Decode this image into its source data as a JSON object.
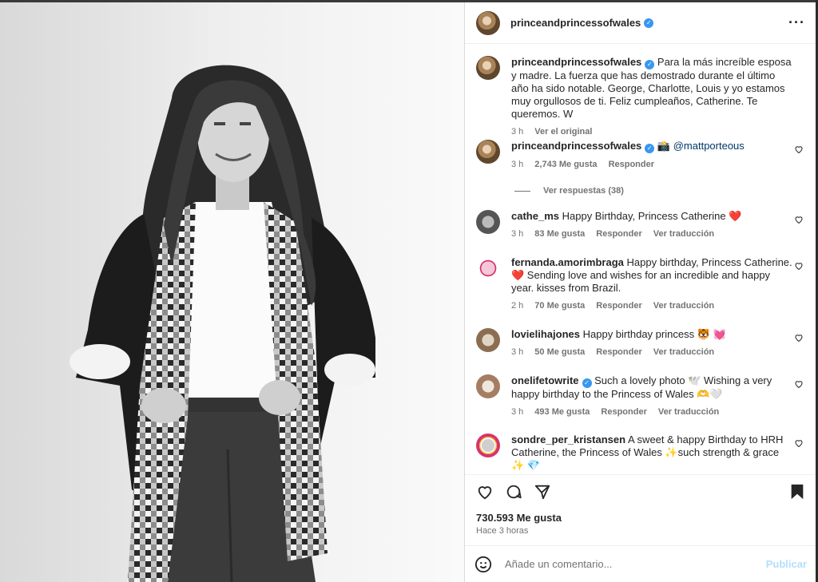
{
  "post": {
    "author": "princeandprincessofwales",
    "caption": "Para la más increíble esposa y madre. La fuerza que has demostrado durante el último año ha sido notable. George, Charlotte, Louis y yo estamos muy orgullosos de ti. Feliz cumpleaños, Catherine. Te queremos. W",
    "caption_time": "3 h",
    "see_original": "Ver el original",
    "likes": "730.593 Me gusta",
    "time_ago": "Hace 3 horas"
  },
  "comments": [
    {
      "user": "princeandprincessofwales",
      "verified": true,
      "text": "📸",
      "mention": "@mattporteous",
      "time": "3 h",
      "likes": "2,743 Me gusta",
      "reply": "Responder",
      "view_replies": "Ver respuestas (38)"
    },
    {
      "user": "cathe_ms",
      "text": "Happy Birthday, Princess Catherine ❤️",
      "time": "3 h",
      "likes": "83 Me gusta",
      "reply": "Responder",
      "translate": "Ver traducción"
    },
    {
      "user": "fernanda.amorimbraga",
      "text": "Happy birthday, Princess Catherine. ❤️ Sending love and wishes for an incredible and happy year. kisses from Brazil.",
      "time": "2 h",
      "likes": "70 Me gusta",
      "reply": "Responder",
      "translate": "Ver traducción"
    },
    {
      "user": "lovielihajones",
      "text": "Happy birthday princess 🐯 💓",
      "time": "3 h",
      "likes": "50 Me gusta",
      "reply": "Responder",
      "translate": "Ver traducción"
    },
    {
      "user": "onelifetowrite",
      "verified": true,
      "text": "Such a lovely photo 🕊️ Wishing a very happy birthday to the Princess of Wales 🫶🤍",
      "time": "3 h",
      "likes": "493 Me gusta",
      "reply": "Responder",
      "translate": "Ver traducción"
    },
    {
      "user": "sondre_per_kristansen",
      "text": "A sweet & happy Birthday to HRH Catherine, the Princess of Wales ✨such strength & grace ✨ 💎"
    }
  ],
  "composer": {
    "placeholder": "Añade un comentario...",
    "publish": "Publicar"
  },
  "icons": {
    "like": "heart-icon",
    "comment": "comment-icon",
    "share": "share-icon",
    "save": "bookmark-icon",
    "emoji": "emoji-icon",
    "more": "more-options-icon"
  }
}
